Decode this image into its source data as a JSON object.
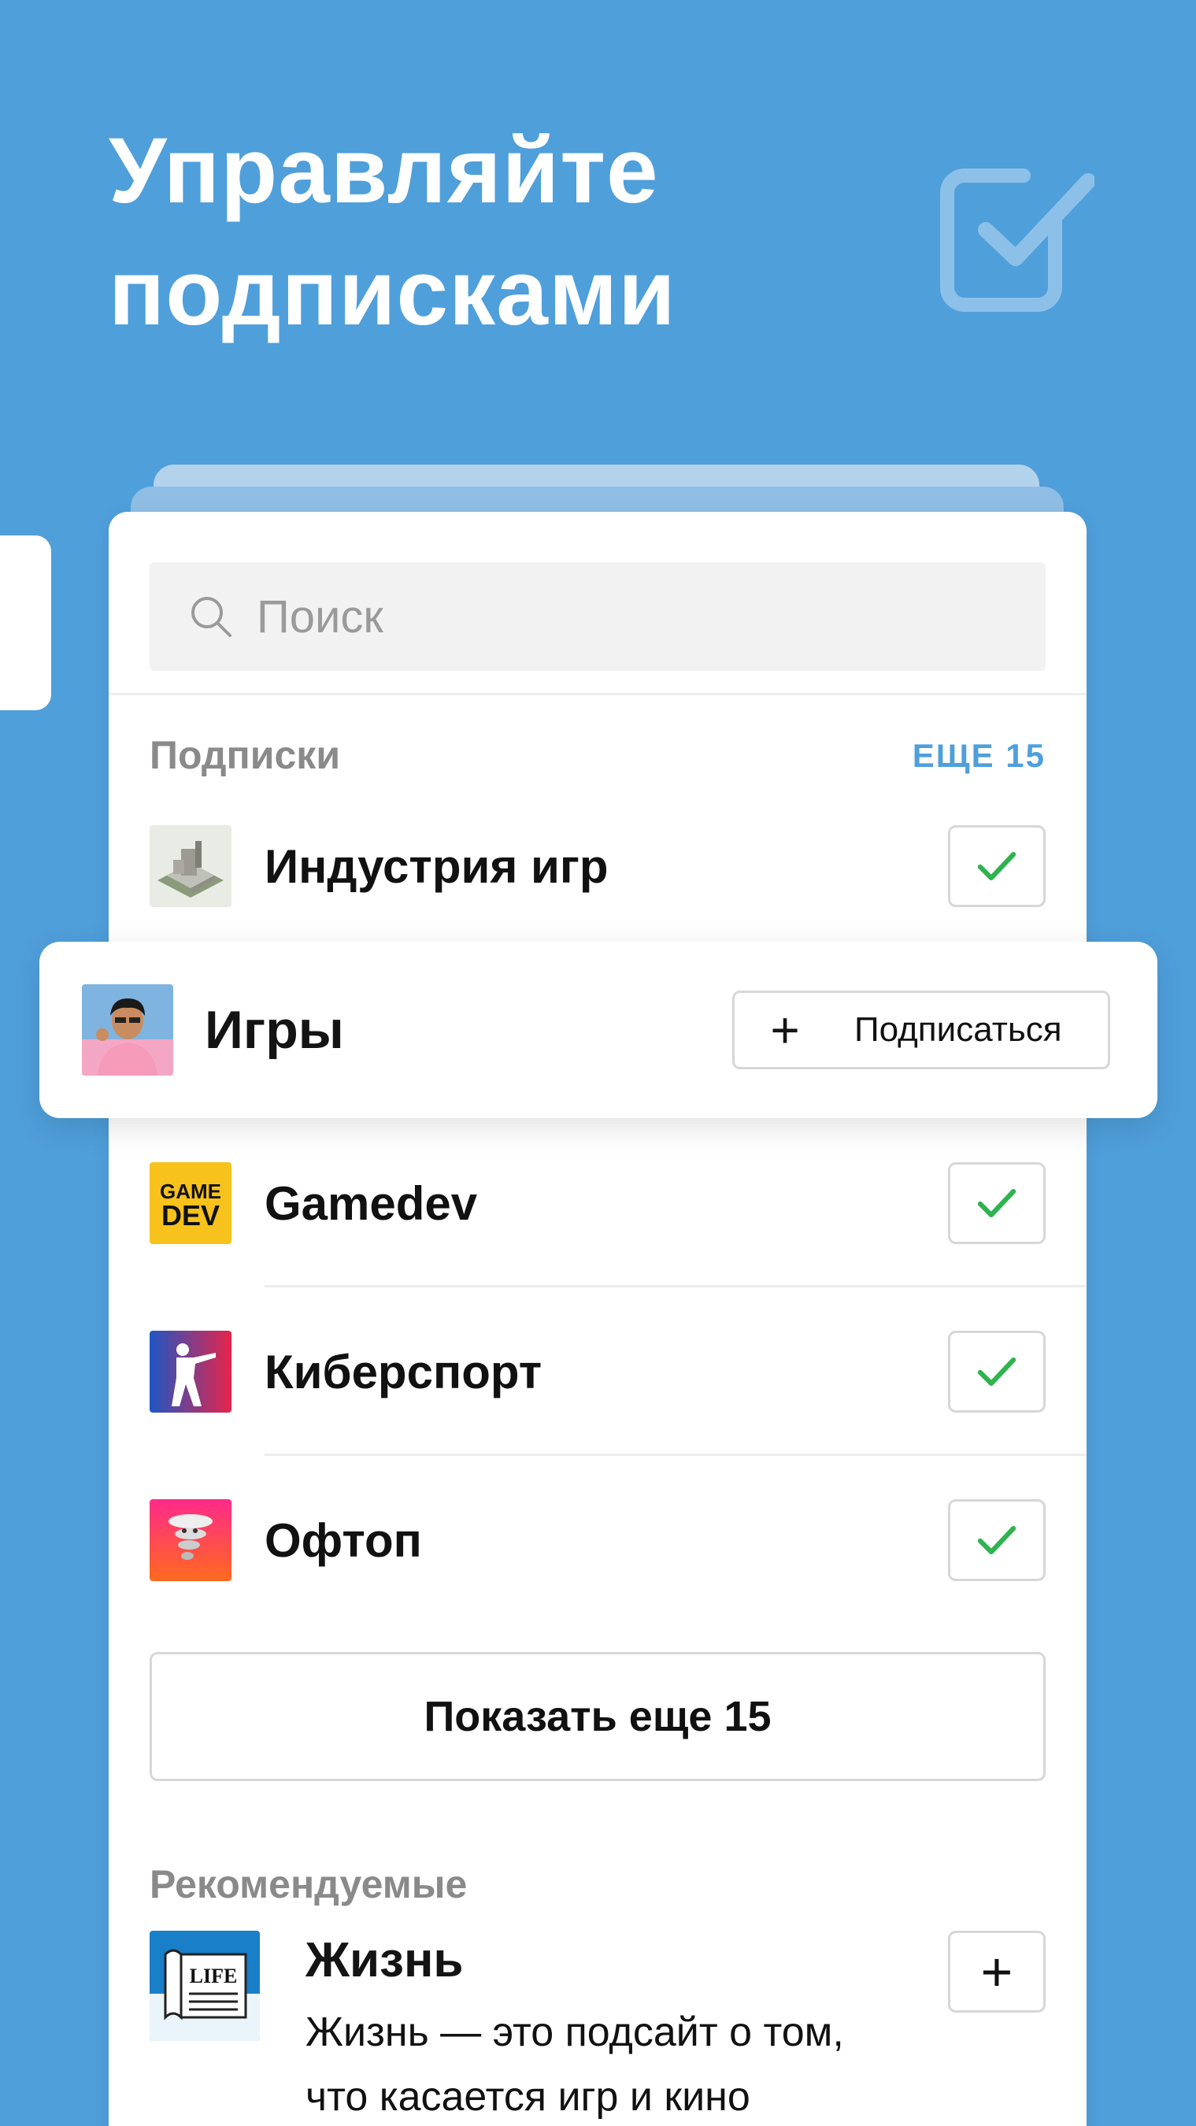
{
  "headline": {
    "line1": "Управляйте",
    "line2": "подписками"
  },
  "search": {
    "placeholder": "Поиск"
  },
  "subscriptions": {
    "title": "Подписки",
    "more_label": "ЕЩЕ 15",
    "items": [
      {
        "name": "Индустрия игр",
        "icon": "factory-icon",
        "subscribed": true
      },
      {
        "name": "Gamedev",
        "icon": "gamedev-logo",
        "logo_text": [
          "GAME",
          "DEV"
        ],
        "subscribed": true
      },
      {
        "name": "Киберспорт",
        "icon": "counter-strike-icon",
        "subscribed": true
      },
      {
        "name": "Офтоп",
        "icon": "tornado-icon",
        "subscribed": true
      }
    ],
    "show_more_label": "Показать еще 15"
  },
  "floating": {
    "name": "Игры",
    "icon": "gamer-avatar",
    "button_label": "Подписаться",
    "button_icon": "+"
  },
  "recommended": {
    "title": "Рекомендуемые",
    "items": [
      {
        "name": "Жизнь",
        "icon": "newspaper-icon",
        "logo_text": "LIFE",
        "description": "Жизнь — это подсайт о том, что касается игр и кино",
        "add_icon": "+"
      }
    ]
  },
  "colors": {
    "background": "#4f9fdb",
    "accent": "#4f9fdb",
    "check": "#2eb34f"
  }
}
